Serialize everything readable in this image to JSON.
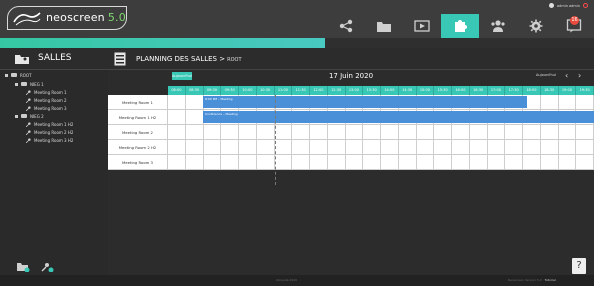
{
  "app": {
    "logo_text": "neoscreen",
    "version": "5.0",
    "user": "admin admin"
  },
  "nav": [
    {
      "label": "TABLEAU DE BORD",
      "icon": "share-icon",
      "active": false
    },
    {
      "label": "MÉDIATHÈQUE",
      "icon": "folder-icon",
      "active": false
    },
    {
      "label": "DIFFUSION",
      "icon": "play-icon",
      "active": false
    },
    {
      "label": "MODULES",
      "icon": "puzzle-icon",
      "active": true
    },
    {
      "label": "UTILISATEURS",
      "icon": "users-icon",
      "active": false
    },
    {
      "label": "PARAMÈTRES",
      "icon": "gear-icon",
      "active": false
    },
    {
      "label": "▶ NOTIFICATIONS",
      "icon": "notifications-icon",
      "active": false,
      "badge": "16"
    }
  ],
  "sidebar": {
    "title": "SALLES",
    "tree": [
      {
        "label": "ROOT",
        "type": "root"
      },
      {
        "label": "NIEG 1",
        "type": "group"
      },
      {
        "label": "Meeting Room 1",
        "type": "room"
      },
      {
        "label": "Meeting Room 2",
        "type": "room"
      },
      {
        "label": "Meeting Room 3",
        "type": "room"
      },
      {
        "label": "NIEG 2",
        "type": "group"
      },
      {
        "label": "Meeting Room 1 H2",
        "type": "room"
      },
      {
        "label": "Meeting Room 2 H2",
        "type": "room"
      },
      {
        "label": "Meeting Room 3 H2",
        "type": "room"
      }
    ]
  },
  "planning": {
    "title": "PLANNING DES SALLES >",
    "breadcrumb": "ROOT",
    "today_button": "Aujourd'hui",
    "date": "17 Juin 2020",
    "view_label": "Aujourd'hui",
    "hours": [
      "08:00",
      "08:30",
      "09:00",
      "09:30",
      "10:00",
      "10:30",
      "11:00",
      "11:30",
      "12:00",
      "12:30",
      "13:00",
      "13:30",
      "14:00",
      "14:30",
      "15:00",
      "15:30",
      "16:00",
      "16:30",
      "17:00",
      "17:30",
      "18:00",
      "18:30",
      "19:00",
      "19:30"
    ],
    "rooms": [
      "Meeting Room 1",
      "Meeting Room 1 H2",
      "Meeting Room 2",
      "Meeting Room 2 H2",
      "Meeting Room 3"
    ],
    "bookings": [
      {
        "room": "Meeting Room 1",
        "label": "8:00 PM – Meeting"
      },
      {
        "room": "Meeting Room 1 H2",
        "label": "Conférence – Meeting"
      }
    ]
  },
  "footer": {
    "center": "Ubiquité 2020",
    "right": "Neoscreen Version 5.0",
    "link": "Tutoriel"
  },
  "help": "?",
  "colors": {
    "accent": "#39c8b5",
    "booking": "#4a90d9",
    "badge": "#e84b3c"
  }
}
